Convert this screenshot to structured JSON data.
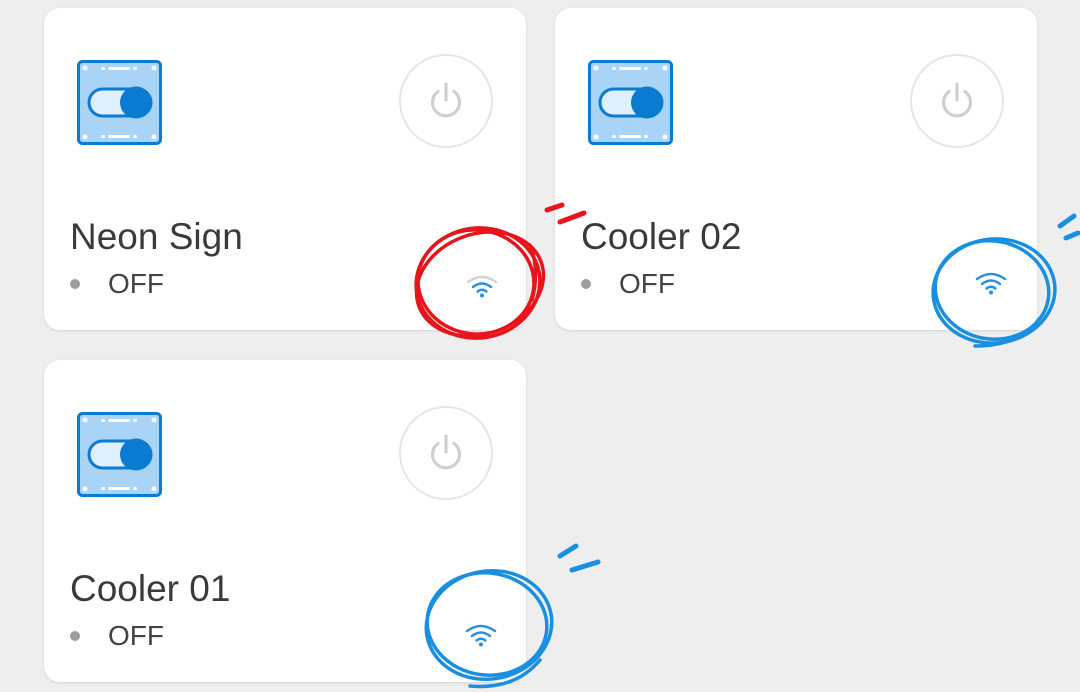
{
  "devices": [
    {
      "name": "Neon Sign",
      "status": "OFF",
      "icon": "switch-icon",
      "power_icon": "power-icon",
      "signal_icon": "wifi-icon"
    },
    {
      "name": "Cooler 02",
      "status": "OFF",
      "icon": "switch-icon",
      "power_icon": "power-icon",
      "signal_icon": "wifi-icon"
    },
    {
      "name": "Cooler 01",
      "status": "OFF",
      "icon": "switch-icon",
      "power_icon": "power-icon",
      "signal_icon": "wifi-icon"
    }
  ],
  "colors": {
    "background": "#eeeeee",
    "card": "#ffffff",
    "icon_fill": "#a9d4f5",
    "icon_blue": "#0b7bd1",
    "power_gray": "#cfcfcf",
    "status_dot": "#9e9e9e",
    "red_marker": "#e8141c",
    "blue_marker": "#1a8fe0"
  }
}
